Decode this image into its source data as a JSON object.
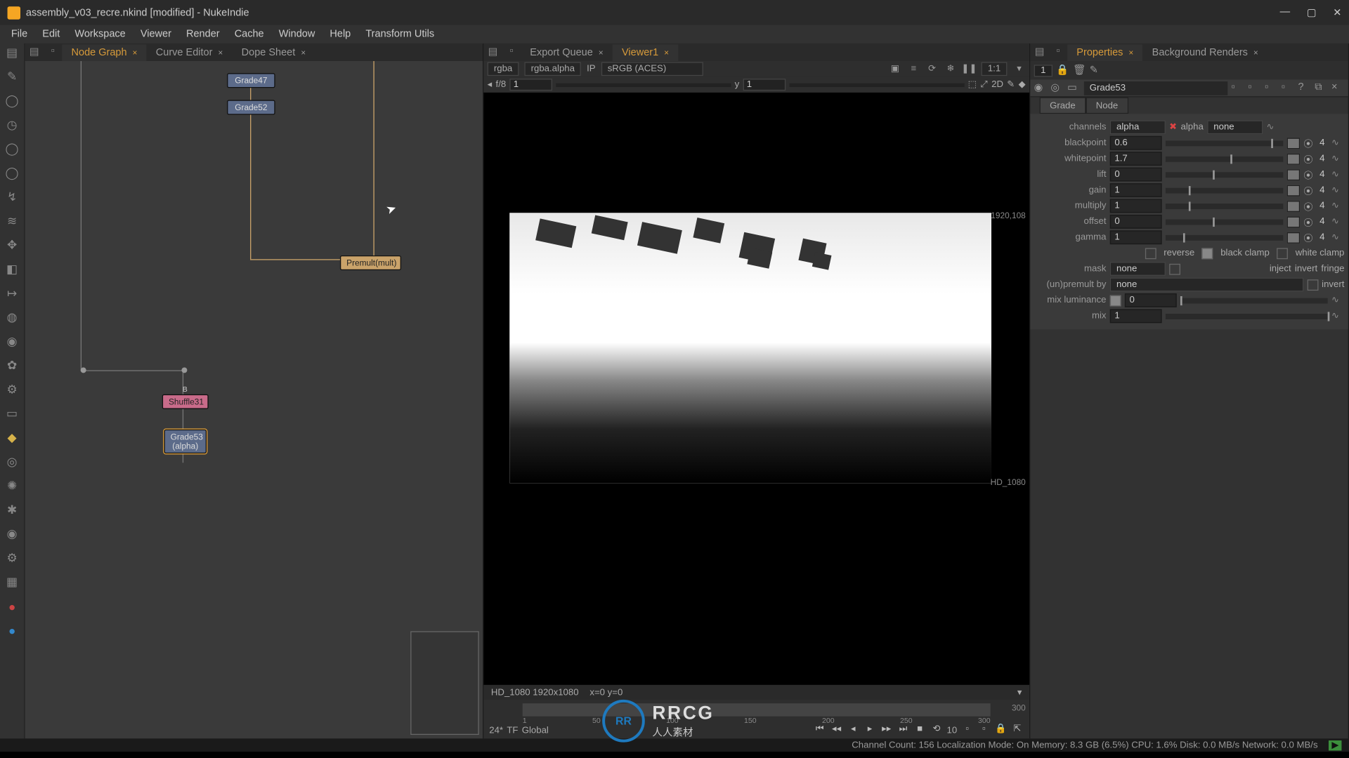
{
  "window": {
    "title": "assembly_v03_recre.nkind [modified] - NukeIndie"
  },
  "menu": {
    "items": [
      "File",
      "Edit",
      "Workspace",
      "Viewer",
      "Render",
      "Cache",
      "Window",
      "Help",
      "Transform Utils"
    ]
  },
  "left_tabs": {
    "items": [
      "Node Graph",
      "Curve Editor",
      "Dope Sheet"
    ],
    "active": 0
  },
  "mid_tabs": {
    "items": [
      "Export Queue",
      "Viewer1"
    ],
    "active": 1
  },
  "right_tabs": {
    "items": [
      "Properties",
      "Background Renders"
    ],
    "active": 0
  },
  "nodes": {
    "grade47": "Grade47",
    "grade52": "Grade52",
    "shuffle": "Shuffle31",
    "grade53": "Grade53\n(alpha)",
    "merge": "Premult(mult)"
  },
  "viewer": {
    "channels": "rgba",
    "layer": "rgba.alpha",
    "colorspace": "sRGB (ACES)",
    "ip_label": "IP",
    "zoom": "1:1",
    "fstop_label": "f/8",
    "x_val": "1",
    "y_label": "y",
    "y_val": "1",
    "mode": "2D",
    "res_tr": "1920,108",
    "res_br": "HD_1080",
    "status": "HD_1080 1920x1080",
    "coords": "x=0 y=0"
  },
  "timeline": {
    "ticks": [
      "1",
      "50",
      "100",
      "150",
      "200",
      "250",
      "300"
    ],
    "end": "300",
    "fps": "24*",
    "tf": "TF",
    "scope": "Global",
    "step": "10"
  },
  "prop": {
    "node_name": "Grade53",
    "tabs": [
      "Grade",
      "Node"
    ],
    "channels_lbl": "channels",
    "channels_val": "alpha",
    "channels2": "alpha",
    "channels3": "none",
    "blackpoint_lbl": "blackpoint",
    "blackpoint_val": "0.6",
    "whitepoint_lbl": "whitepoint",
    "whitepoint_val": "1.7",
    "lift_lbl": "lift",
    "lift_val": "0",
    "gain_lbl": "gain",
    "gain_val": "1",
    "multiply_lbl": "multiply",
    "multiply_val": "1",
    "offset_lbl": "offset",
    "offset_val": "0",
    "gamma_lbl": "gamma",
    "gamma_val": "1",
    "reverse_lbl": "reverse",
    "blackclamp_lbl": "black clamp",
    "whiteclamp_lbl": "white clamp",
    "mask_lbl": "mask",
    "mask_val": "none",
    "inject_lbl": "inject",
    "invert_lbl": "invert",
    "fringe_lbl": "fringe",
    "unpremult_lbl": "(un)premult by",
    "unpremult_val": "none",
    "unpremult_invert": "invert",
    "mixluma_lbl": "mix luminance",
    "mixluma_val": "0",
    "mix_lbl": "mix",
    "mix_val": "1"
  },
  "status": {
    "text": "Channel Count: 156 Localization Mode: On Memory: 8.3 GB (6.5%) CPU: 1.6% Disk: 0.0 MB/s Network: 0.0 MB/s",
    "badge": "▶"
  },
  "watermark": {
    "logo": "RR",
    "text": "RRCG",
    "sub": "人人素材"
  }
}
